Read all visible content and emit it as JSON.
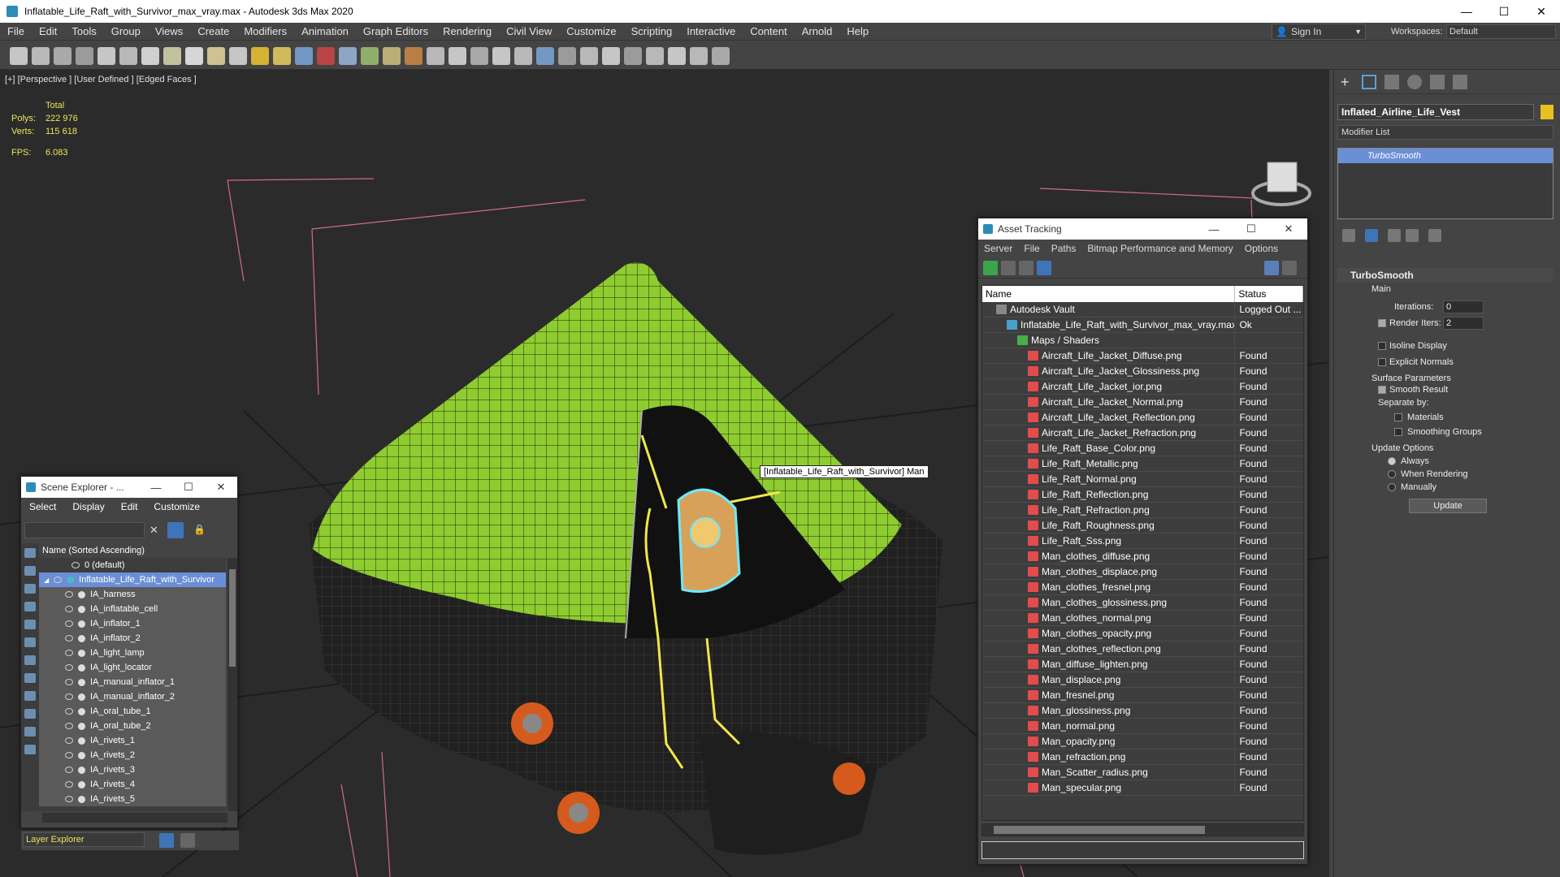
{
  "window": {
    "title": "Inflatable_Life_Raft_with_Survivor_max_vray.max - Autodesk 3ds Max 2020",
    "min": "—",
    "max": "☐",
    "close": "✕"
  },
  "menu": [
    "File",
    "Edit",
    "Tools",
    "Group",
    "Views",
    "Create",
    "Modifiers",
    "Animation",
    "Graph Editors",
    "Rendering",
    "Civil View",
    "Customize",
    "Scripting",
    "Interactive",
    "Content",
    "Arnold",
    "Help"
  ],
  "signin": {
    "label": "Sign In"
  },
  "workspaces": {
    "label": "Workspaces:",
    "value": "Default"
  },
  "viewport": {
    "label": "[+] [Perspective ] [User Defined ] [Edged Faces ]",
    "stats": {
      "total": "Total",
      "polys_label": "Polys:",
      "polys": "222 976",
      "verts_label": "Verts:",
      "verts": "115 618",
      "fps_label": "FPS:",
      "fps": "6.083"
    },
    "tooltip": "[Inflatable_Life_Raft_with_Survivor] Man"
  },
  "asset_tracking": {
    "title": "Asset Tracking",
    "menu": [
      "Server",
      "File",
      "Paths",
      "Bitmap Performance and Memory",
      "Options"
    ],
    "col_name": "Name",
    "col_status": "Status",
    "rows": [
      {
        "name": "Autodesk Vault",
        "status": "Logged Out ...",
        "indent": 1,
        "type": "vault"
      },
      {
        "name": "Inflatable_Life_Raft_with_Survivor_max_vray.max",
        "status": "Ok",
        "indent": 2,
        "type": "max"
      },
      {
        "name": "Maps / Shaders",
        "status": "",
        "indent": 3,
        "type": "folder"
      },
      {
        "name": "Aircraft_Life_Jacket_Diffuse.png",
        "status": "Found",
        "indent": 4,
        "type": "png"
      },
      {
        "name": "Aircraft_Life_Jacket_Glossiness.png",
        "status": "Found",
        "indent": 4,
        "type": "png"
      },
      {
        "name": "Aircraft_Life_Jacket_ior.png",
        "status": "Found",
        "indent": 4,
        "type": "png"
      },
      {
        "name": "Aircraft_Life_Jacket_Normal.png",
        "status": "Found",
        "indent": 4,
        "type": "png"
      },
      {
        "name": "Aircraft_Life_Jacket_Reflection.png",
        "status": "Found",
        "indent": 4,
        "type": "png"
      },
      {
        "name": "Aircraft_Life_Jacket_Refraction.png",
        "status": "Found",
        "indent": 4,
        "type": "png"
      },
      {
        "name": "Life_Raft_Base_Color.png",
        "status": "Found",
        "indent": 4,
        "type": "png"
      },
      {
        "name": "Life_Raft_Metallic.png",
        "status": "Found",
        "indent": 4,
        "type": "png"
      },
      {
        "name": "Life_Raft_Normal.png",
        "status": "Found",
        "indent": 4,
        "type": "png"
      },
      {
        "name": "Life_Raft_Reflection.png",
        "status": "Found",
        "indent": 4,
        "type": "png"
      },
      {
        "name": "Life_Raft_Refraction.png",
        "status": "Found",
        "indent": 4,
        "type": "png"
      },
      {
        "name": "Life_Raft_Roughness.png",
        "status": "Found",
        "indent": 4,
        "type": "png"
      },
      {
        "name": "Life_Raft_Sss.png",
        "status": "Found",
        "indent": 4,
        "type": "png"
      },
      {
        "name": "Man_clothes_diffuse.png",
        "status": "Found",
        "indent": 4,
        "type": "png"
      },
      {
        "name": "Man_clothes_displace.png",
        "status": "Found",
        "indent": 4,
        "type": "png"
      },
      {
        "name": "Man_clothes_fresnel.png",
        "status": "Found",
        "indent": 4,
        "type": "png"
      },
      {
        "name": "Man_clothes_glossiness.png",
        "status": "Found",
        "indent": 4,
        "type": "png"
      },
      {
        "name": "Man_clothes_normal.png",
        "status": "Found",
        "indent": 4,
        "type": "png"
      },
      {
        "name": "Man_clothes_opacity.png",
        "status": "Found",
        "indent": 4,
        "type": "png"
      },
      {
        "name": "Man_clothes_reflection.png",
        "status": "Found",
        "indent": 4,
        "type": "png"
      },
      {
        "name": "Man_diffuse_lighten.png",
        "status": "Found",
        "indent": 4,
        "type": "png"
      },
      {
        "name": "Man_displace.png",
        "status": "Found",
        "indent": 4,
        "type": "png"
      },
      {
        "name": "Man_fresnel.png",
        "status": "Found",
        "indent": 4,
        "type": "png"
      },
      {
        "name": "Man_glossiness.png",
        "status": "Found",
        "indent": 4,
        "type": "png"
      },
      {
        "name": "Man_normal.png",
        "status": "Found",
        "indent": 4,
        "type": "png"
      },
      {
        "name": "Man_opacity.png",
        "status": "Found",
        "indent": 4,
        "type": "png"
      },
      {
        "name": "Man_refraction.png",
        "status": "Found",
        "indent": 4,
        "type": "png"
      },
      {
        "name": "Man_Scatter_radius.png",
        "status": "Found",
        "indent": 4,
        "type": "png"
      },
      {
        "name": "Man_specular.png",
        "status": "Found",
        "indent": 4,
        "type": "png"
      }
    ]
  },
  "scene_explorer": {
    "title": "Scene Explorer - ...",
    "menu": [
      "Select",
      "Display",
      "Edit",
      "Customize"
    ],
    "header": "Name (Sorted Ascending)",
    "items": [
      {
        "name": "0 (default)",
        "level": 0
      },
      {
        "name": "Inflatable_Life_Raft_with_Survivor",
        "level": 1,
        "selected": true
      },
      {
        "name": "IA_harness",
        "level": 2
      },
      {
        "name": "IA_inflatable_cell",
        "level": 2
      },
      {
        "name": "IA_inflator_1",
        "level": 2
      },
      {
        "name": "IA_inflator_2",
        "level": 2
      },
      {
        "name": "IA_light_lamp",
        "level": 2
      },
      {
        "name": "IA_light_locator",
        "level": 2
      },
      {
        "name": "IA_manual_inflator_1",
        "level": 2
      },
      {
        "name": "IA_manual_inflator_2",
        "level": 2
      },
      {
        "name": "IA_oral_tube_1",
        "level": 2
      },
      {
        "name": "IA_oral_tube_2",
        "level": 2
      },
      {
        "name": "IA_rivets_1",
        "level": 2
      },
      {
        "name": "IA_rivets_2",
        "level": 2
      },
      {
        "name": "IA_rivets_3",
        "level": 2
      },
      {
        "name": "IA_rivets_4",
        "level": 2
      },
      {
        "name": "IA_rivets_5",
        "level": 2
      }
    ],
    "layer_explorer": "Layer Explorer"
  },
  "command_panel": {
    "object_name": "Inflated_Airline_Life_Vest",
    "modifier_list": "Modifier List",
    "stack_item": "TurboSmooth",
    "rollout_title": "TurboSmooth",
    "main": "Main",
    "iterations_label": "Iterations:",
    "iterations": "0",
    "render_iters_label": "Render Iters:",
    "render_iters": "2",
    "isoline": "Isoline Display",
    "explicit": "Explicit Normals",
    "surface_params": "Surface Parameters",
    "smooth_result": "Smooth Result",
    "separate_by": "Separate by:",
    "materials": "Materials",
    "smoothing_groups": "Smoothing Groups",
    "update_options": "Update Options",
    "always": "Always",
    "when_rendering": "When Rendering",
    "manually": "Manually",
    "update": "Update"
  }
}
